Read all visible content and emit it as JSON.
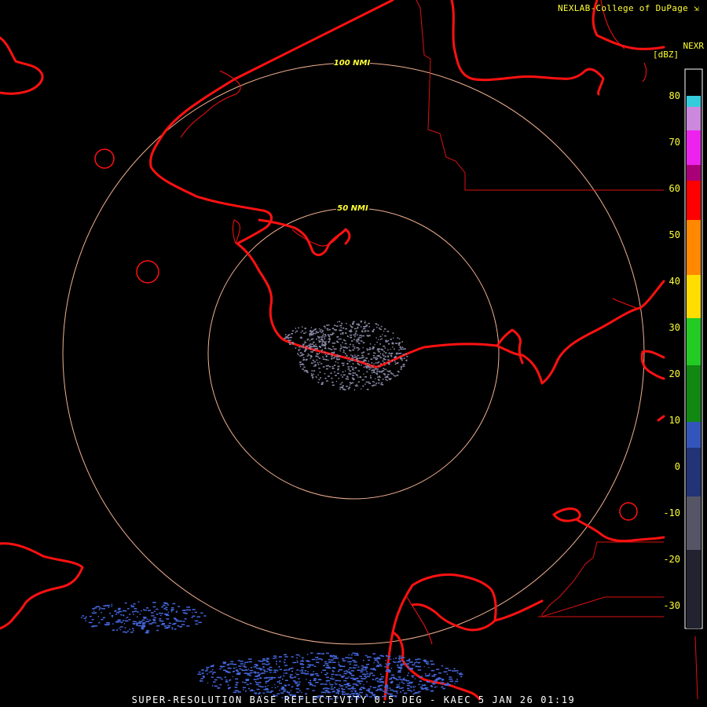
{
  "header": {
    "credit": "NEXLAB-College of DuPage",
    "credit_icon": "arrow-icon",
    "product_code": "NEXR",
    "units": "[dBZ]"
  },
  "rings": [
    {
      "label": "100 NMI"
    },
    {
      "label": "50 NMI"
    }
  ],
  "color_scale": {
    "ticks": [
      "80",
      "70",
      "60",
      "50",
      "40",
      "30",
      "20",
      "10",
      "0",
      "-10",
      "-20",
      "-30"
    ],
    "colors": {
      "pink_max": "#ff55aa",
      "cyan": "#33ccdd",
      "magenta": "#ee22ee",
      "red": "#ff0000",
      "orange": "#ff8800",
      "yellow": "#ffff00",
      "green": "#22bb22",
      "blue": "#3355bb",
      "dark_blue": "#1a2a66",
      "gray": "#666677"
    }
  },
  "map_colors": {
    "coastline": "#ff1111",
    "boundary": "#dd1111",
    "range_ring": "#f0b090",
    "echo_near": "#8a8aa8",
    "echo_far": "#4466dd"
  },
  "footer": {
    "caption": "SUPER-RESOLUTION BASE REFLECTIVITY 0.5 DEG - KAEC 5 JAN 26 01:19"
  }
}
